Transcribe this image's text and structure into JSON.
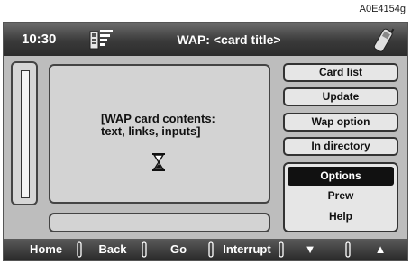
{
  "ref_code": "A0E4154g",
  "header": {
    "time": "10:30",
    "title": "WAP: <card title>"
  },
  "content": {
    "text": "[WAP card contents:\ntext, links, inputs]"
  },
  "side_buttons": [
    "Card list",
    "Update",
    "Wap option",
    "In directory"
  ],
  "menu": {
    "items": [
      "Options",
      "Prew",
      "Help"
    ],
    "selected_index": 0
  },
  "bottom_bar": {
    "home": "Home",
    "back": "Back",
    "go": "Go",
    "interrupt": "Interrupt",
    "down": "▼",
    "up": "▲"
  },
  "icons": {
    "signal": "signal-strength-icon",
    "phone": "mobile-phone-icon",
    "hourglass": "hourglass-icon"
  }
}
